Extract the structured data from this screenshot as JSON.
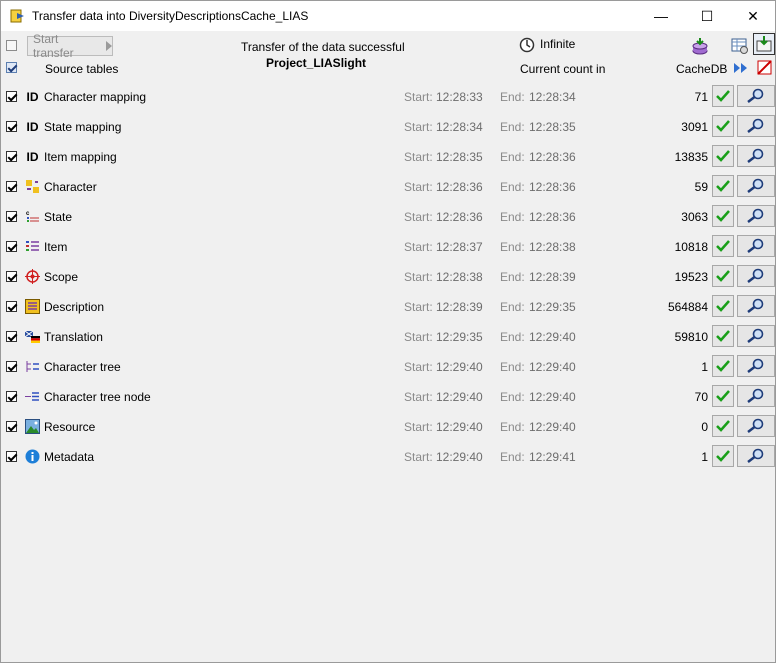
{
  "window": {
    "title": "Transfer data into DiversityDescriptionsCache_LIAS"
  },
  "window_controls": {
    "minimize": "—",
    "maximize": "☐",
    "close": "✕"
  },
  "toolbar": {
    "start_label": "Start transfer",
    "status_text": "Transfer of the data successful",
    "project_name": "Project_LIASlight",
    "timer_label": "Infinite",
    "source_tables_label": "Source tables",
    "current_count_label": "Current count in",
    "cachedb_label": "CacheDB"
  },
  "start_label": "Start:",
  "end_label": "End:",
  "rows": [
    {
      "name": "Character mapping",
      "icon": "id-icon",
      "icon_text": "ID",
      "start": "12:28:33",
      "end": "12:28:34",
      "count": "71"
    },
    {
      "name": "State mapping",
      "icon": "id-icon",
      "icon_text": "ID",
      "start": "12:28:34",
      "end": "12:28:35",
      "count": "3091"
    },
    {
      "name": "Item mapping",
      "icon": "id-icon",
      "icon_text": "ID",
      "start": "12:28:35",
      "end": "12:28:36",
      "count": "13835"
    },
    {
      "name": "Character",
      "icon": "character-icon",
      "icon_text": "",
      "start": "12:28:36",
      "end": "12:28:36",
      "count": "59"
    },
    {
      "name": "State",
      "icon": "state-icon",
      "icon_text": "",
      "start": "12:28:36",
      "end": "12:28:36",
      "count": "3063"
    },
    {
      "name": "Item",
      "icon": "item-icon",
      "icon_text": "",
      "start": "12:28:37",
      "end": "12:28:38",
      "count": "10818"
    },
    {
      "name": "Scope",
      "icon": "scope-icon",
      "icon_text": "",
      "start": "12:28:38",
      "end": "12:28:39",
      "count": "19523"
    },
    {
      "name": "Description",
      "icon": "description-icon",
      "icon_text": "",
      "start": "12:28:39",
      "end": "12:29:35",
      "count": "564884"
    },
    {
      "name": "Translation",
      "icon": "translation-icon",
      "icon_text": "",
      "start": "12:29:35",
      "end": "12:29:40",
      "count": "59810"
    },
    {
      "name": "Character tree",
      "icon": "character-tree-icon",
      "icon_text": "",
      "start": "12:29:40",
      "end": "12:29:40",
      "count": "1"
    },
    {
      "name": "Character tree node",
      "icon": "character-tree-node-icon",
      "icon_text": "",
      "start": "12:29:40",
      "end": "12:29:40",
      "count": "70"
    },
    {
      "name": "Resource",
      "icon": "resource-icon",
      "icon_text": "",
      "start": "12:29:40",
      "end": "12:29:40",
      "count": "0"
    },
    {
      "name": "Metadata",
      "icon": "info-icon",
      "icon_text": "",
      "start": "12:29:40",
      "end": "12:29:41",
      "count": "1"
    }
  ]
}
